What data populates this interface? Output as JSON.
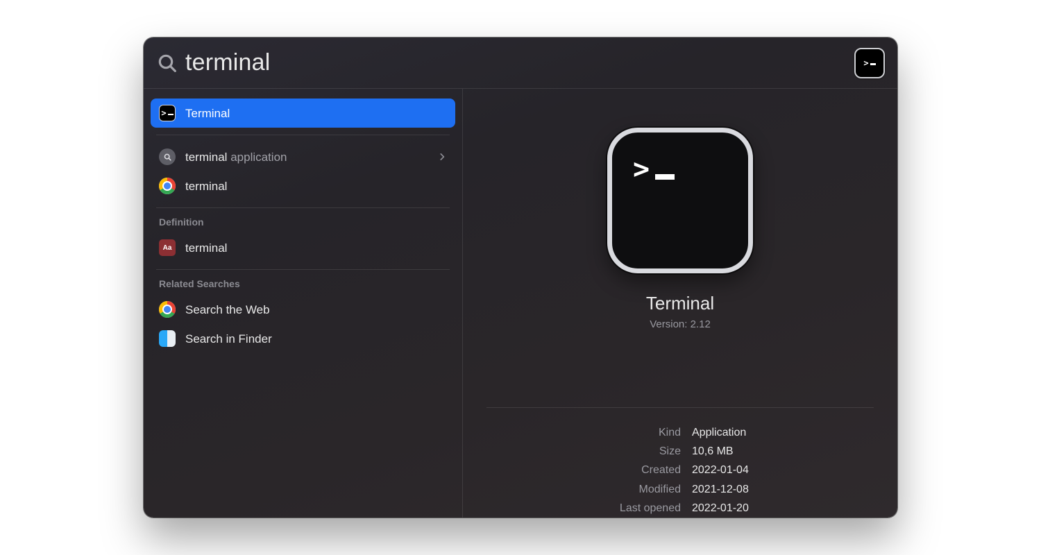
{
  "search": {
    "query": "terminal"
  },
  "groups": {
    "definition": "Definition",
    "related": "Related Searches"
  },
  "results": {
    "top": [
      {
        "label": "Terminal",
        "icon": "terminal-icon",
        "selected": true
      }
    ],
    "suggestions": [
      {
        "term": "terminal",
        "suffix": " application",
        "icon": "search-glyph-icon",
        "disclosure": true
      },
      {
        "label": "terminal",
        "icon": "chrome-icon"
      }
    ],
    "definition": [
      {
        "label": "terminal",
        "icon": "dictionary-icon"
      }
    ],
    "related": [
      {
        "label": "Search the Web",
        "icon": "chrome-icon"
      },
      {
        "label": "Search in Finder",
        "icon": "finder-icon"
      }
    ]
  },
  "preview": {
    "name": "Terminal",
    "version": "Version: 2.12",
    "meta": [
      {
        "k": "Kind",
        "v": "Application"
      },
      {
        "k": "Size",
        "v": "10,6 MB"
      },
      {
        "k": "Created",
        "v": "2022-01-04"
      },
      {
        "k": "Modified",
        "v": "2021-12-08"
      },
      {
        "k": "Last opened",
        "v": "2022-01-20"
      }
    ]
  },
  "colors": {
    "selection": "#1e6ff2"
  }
}
